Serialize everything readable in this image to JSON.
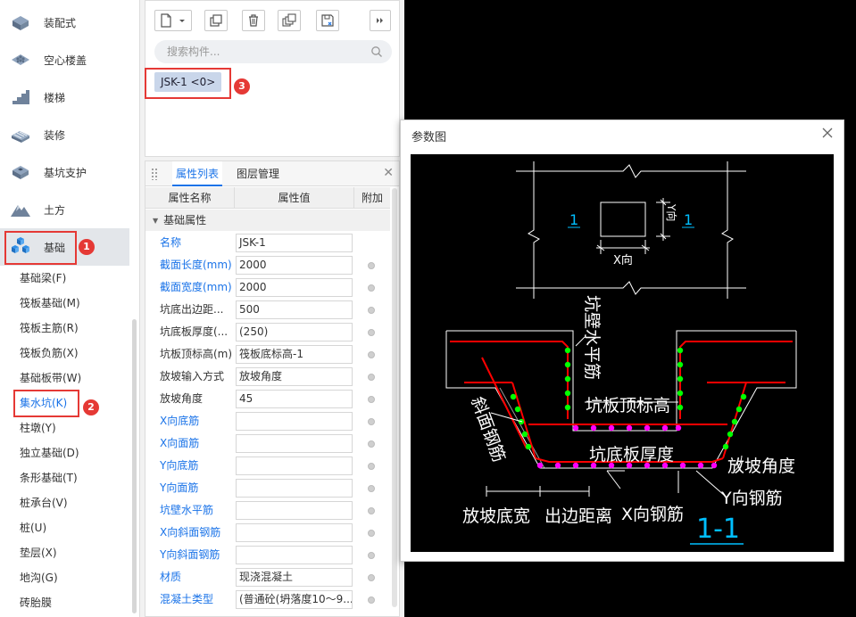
{
  "nav": {
    "categories": [
      {
        "label": "装配式",
        "icon": "prefab-icon"
      },
      {
        "label": "空心楼盖",
        "icon": "hollow-slab-icon"
      },
      {
        "label": "楼梯",
        "icon": "stairs-icon"
      },
      {
        "label": "装修",
        "icon": "decoration-icon"
      },
      {
        "label": "基坑支护",
        "icon": "pit-support-icon"
      },
      {
        "label": "土方",
        "icon": "earthwork-icon"
      },
      {
        "label": "基础",
        "icon": "foundation-icon"
      }
    ],
    "subitems": [
      "基础梁(F)",
      "筏板基础(M)",
      "筏板主筋(R)",
      "筏板负筋(X)",
      "基础板带(W)",
      "集水坑(K)",
      "柱墩(Y)",
      "独立基础(D)",
      "条形基础(T)",
      "桩承台(V)",
      "桩(U)",
      "垫层(X)",
      "地沟(G)",
      "砖胎膜"
    ]
  },
  "annotations": {
    "badge1": "1",
    "badge2": "2",
    "badge3": "3"
  },
  "list": {
    "search_placeholder": "搜索构件...",
    "chip_label": "JSK-1 <0>"
  },
  "props": {
    "tabs": [
      "属性列表",
      "图层管理"
    ],
    "headers": [
      "属性名称",
      "属性值",
      "附加"
    ],
    "group_label": "基础属性",
    "rows": [
      {
        "name": "名称",
        "value": "JSK-1"
      },
      {
        "name": "截面长度(mm)",
        "value": "2000"
      },
      {
        "name": "截面宽度(mm)",
        "value": "2000"
      },
      {
        "name": "坑底出边距...",
        "value": "500"
      },
      {
        "name": "坑底板厚度(...",
        "value": "(250)"
      },
      {
        "name": "坑板顶标高(m)",
        "value": "筏板底标高-1"
      },
      {
        "name": "放坡输入方式",
        "value": "放坡角度"
      },
      {
        "name": "放坡角度",
        "value": "45"
      },
      {
        "name": "X向底筋",
        "value": ""
      },
      {
        "name": "X向面筋",
        "value": ""
      },
      {
        "name": "Y向底筋",
        "value": ""
      },
      {
        "name": "Y向面筋",
        "value": ""
      },
      {
        "name": "坑壁水平筋",
        "value": ""
      },
      {
        "name": "X向斜面钢筋",
        "value": ""
      },
      {
        "name": "Y向斜面钢筋",
        "value": ""
      },
      {
        "name": "材质",
        "value": "现浇混凝土"
      },
      {
        "name": "混凝土类型",
        "value": "(普通砼(坍落度10～9..."
      }
    ]
  },
  "dialog": {
    "title": "参数图",
    "diagram": {
      "section_mark": "1",
      "y_dir": "Y向",
      "x_dir": "X向",
      "wall_horizontal_bar": "坑壁水平筋",
      "slab_top_elev": "坑板顶标高",
      "slope_bar": "斜面钢筋",
      "slab_thickness": "坑底板厚度",
      "slope_angle": "放坡角度",
      "y_bar": "Y向钢筋",
      "slope_bottom_width": "放坡底宽",
      "edge_distance": "出边距离",
      "x_bar": "X向钢筋",
      "section_title": "1-1"
    }
  },
  "colors": {
    "accent": "#1a73e8",
    "annotation_red": "#e53935",
    "chip_bg": "#c9d6ea",
    "rebar_green": "#00ff00",
    "rebar_magenta": "#ff00ff",
    "cad_red": "#ff0000",
    "cad_cyan": "#00bfff"
  }
}
